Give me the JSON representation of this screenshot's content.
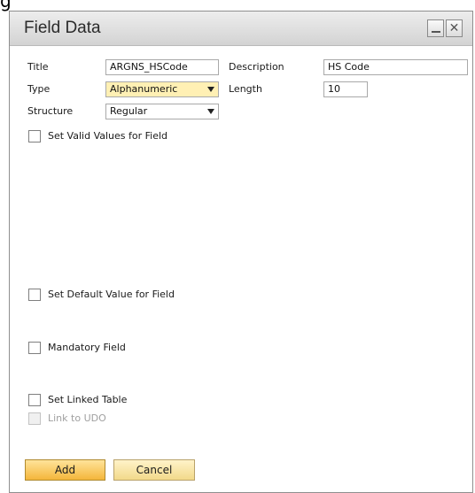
{
  "window": {
    "title": "Field Data",
    "minimize_icon": "minimize-icon",
    "close_icon": "close-icon"
  },
  "form": {
    "title_label": "Title",
    "title_value": "ARGNS_HSCode",
    "description_label": "Description",
    "description_value": "HS Code",
    "type_label": "Type",
    "type_value": "Alphanumeric",
    "length_label": "Length",
    "length_value": "10",
    "structure_label": "Structure",
    "structure_value": "Regular"
  },
  "options": {
    "set_valid_values": "Set Valid Values for Field",
    "set_default_value": "Set Default Value for Field",
    "mandatory_field": "Mandatory Field",
    "set_linked_table": "Set Linked Table",
    "link_to_udo": "Link to UDO"
  },
  "buttons": {
    "add": "Add",
    "cancel": "Cancel"
  },
  "colors": {
    "type_field_bg": "#fff0b4",
    "add_button": "#f4b63b",
    "cancel_button": "#f2d98a"
  }
}
